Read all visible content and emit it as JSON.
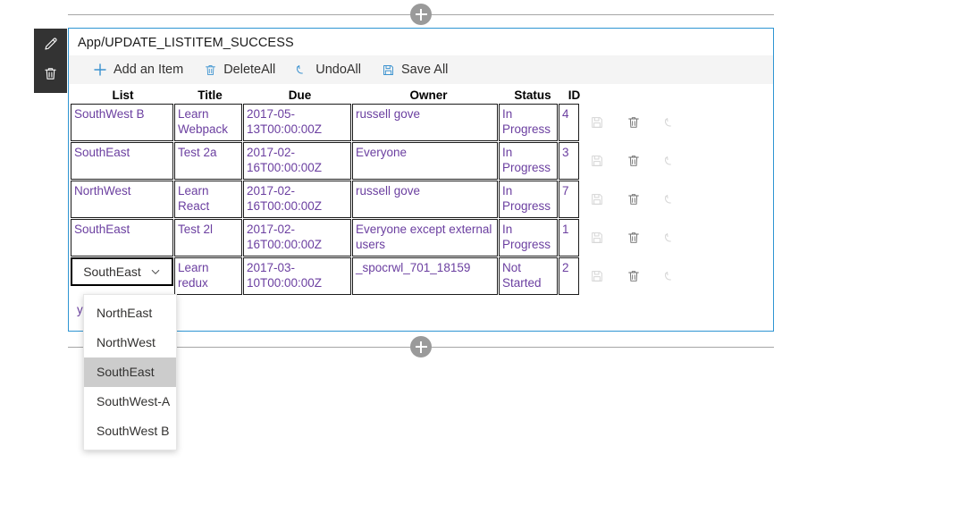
{
  "side_rail": {
    "buttons": [
      {
        "name": "edit-web-part",
        "icon": "pencil-icon"
      },
      {
        "name": "delete-web-part",
        "icon": "trash-icon"
      }
    ]
  },
  "insert_sections": {
    "top_label": "+",
    "bottom_label": "+"
  },
  "panel": {
    "title": "App/UPDATE_LISTITEM_SUCCESS",
    "border_color": "#2e95d3"
  },
  "command_bar": {
    "buttons": [
      {
        "label": "Add an Item",
        "icon": "plus-icon"
      },
      {
        "label": "DeleteAll",
        "icon": "trash-icon"
      },
      {
        "label": "UndoAll",
        "icon": "undo-icon"
      },
      {
        "label": "Save All",
        "icon": "save-icon"
      }
    ]
  },
  "grid": {
    "columns": [
      "List",
      "Title",
      "Due",
      "Owner",
      "Status",
      "ID"
    ],
    "rows": [
      {
        "list": "SouthWest B",
        "title": "Learn Webpack",
        "due": "2017-05-13T00:00:00Z",
        "owner": "russell gove",
        "status": "In Progress",
        "id": "4",
        "save_enabled": false,
        "delete_enabled": true,
        "undo_enabled": false
      },
      {
        "list": "SouthEast",
        "title": "Test 2a",
        "due": "2017-02-16T00:00:00Z",
        "owner": "Everyone",
        "status": "In Progress",
        "id": "3",
        "save_enabled": false,
        "delete_enabled": true,
        "undo_enabled": false
      },
      {
        "list": "NorthWest",
        "title": "Learn React",
        "due": "2017-02-16T00:00:00Z",
        "owner": "russell gove",
        "status": "In Progress",
        "id": "7",
        "save_enabled": false,
        "delete_enabled": true,
        "undo_enabled": false
      },
      {
        "list": "SouthEast",
        "title": "Test 2l",
        "due": "2017-02-16T00:00:00Z",
        "owner": "Everyone except external users",
        "status": "In Progress",
        "id": "1",
        "save_enabled": false,
        "delete_enabled": true,
        "undo_enabled": false
      },
      {
        "list": "SouthEast",
        "title": "Learn redux",
        "due": "2017-03-10T00:00:00Z",
        "owner": "_spocrwl_701_18159",
        "status": "Not Started",
        "id": "2",
        "save_enabled": false,
        "delete_enabled": true,
        "undo_enabled": false
      }
    ]
  },
  "list_combobox": {
    "value": "SouthEast",
    "expanded": true,
    "options": [
      {
        "label": "NorthEast",
        "selected": false
      },
      {
        "label": "NorthWest",
        "selected": false
      },
      {
        "label": "SouthEast",
        "selected": true
      },
      {
        "label": "SouthWest-A",
        "selected": false
      },
      {
        "label": "SouthWest B",
        "selected": false
      }
    ]
  },
  "obscured_cell_fragment": "y",
  "colors": {
    "accent_blue": "#3b92cf",
    "panel_border": "#2e95d3",
    "cell_text": "#6b3fa0",
    "command_bar_bg": "#f4f4f4",
    "rail_bg": "#333333",
    "dropdown_selected_bg": "#cccccc"
  }
}
